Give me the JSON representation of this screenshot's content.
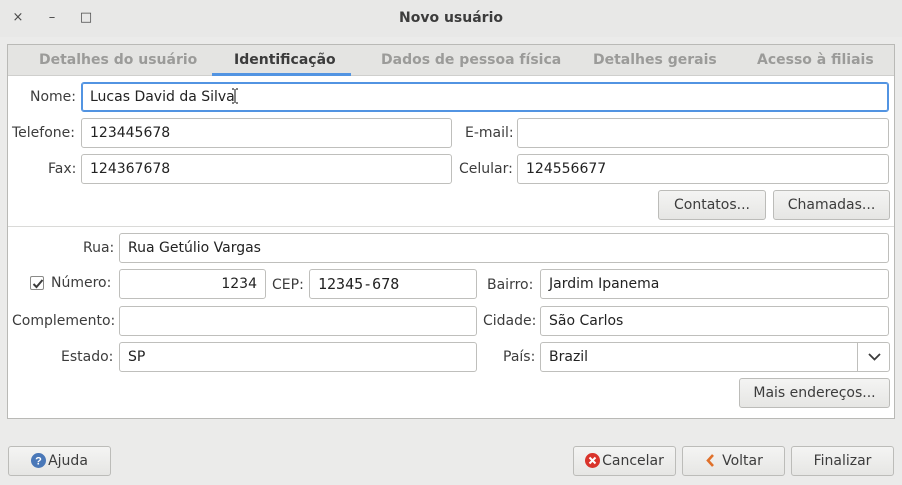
{
  "window": {
    "title": "Novo usuário",
    "close_glyph": "×",
    "minimize_glyph": "–",
    "maximize_glyph": "□"
  },
  "tabs": [
    {
      "label": "Detalhes do usuário",
      "active": false
    },
    {
      "label": "Identificação",
      "active": true
    },
    {
      "label": "Dados de pessoa física",
      "active": false
    },
    {
      "label": "Detalhes gerais",
      "active": false
    },
    {
      "label": "Acesso à filiais",
      "active": false
    }
  ],
  "contact": {
    "nome_label": "Nome:",
    "nome_value": "Lucas David da Silva",
    "telefone_label": "Telefone:",
    "telefone_value": "123445678",
    "email_label": "E-mail:",
    "email_value": "",
    "fax_label": "Fax:",
    "fax_value": "124367678",
    "celular_label": "Celular:",
    "celular_value": "124556677",
    "contatos_button": "Contatos...",
    "chamadas_button": "Chamadas..."
  },
  "address": {
    "rua_label": "Rua:",
    "rua_value": "Rua Getúlio Vargas",
    "numero_label": "Número:",
    "numero_checked": true,
    "numero_value": "1234",
    "cep_label": "CEP:",
    "cep_value": "12345-678",
    "bairro_label": "Bairro:",
    "bairro_value": "Jardim Ipanema",
    "complemento_label": "Complemento:",
    "complemento_value": "",
    "cidade_label": "Cidade:",
    "cidade_value": "São Carlos",
    "estado_label": "Estado:",
    "estado_value": "SP",
    "pais_label": "País:",
    "pais_value": "Brazil",
    "mais_enderecos_button": "Mais endereços..."
  },
  "footer": {
    "ajuda_button": "Ajuda",
    "cancelar_button": "Cancelar",
    "voltar_button": "Voltar",
    "finalizar_button": "Finalizar"
  },
  "colors": {
    "accent": "#5294e2",
    "help_icon": "#4a78b8",
    "cancel_icon": "#d9342b",
    "back_icon": "#e0702a"
  }
}
